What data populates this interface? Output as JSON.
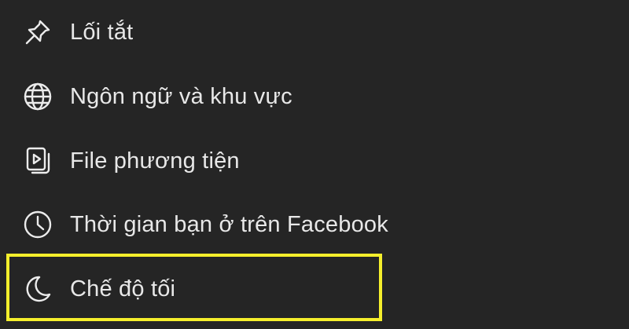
{
  "menu": {
    "items": [
      {
        "label": "Lối tắt",
        "icon": "pin-icon"
      },
      {
        "label": "Ngôn ngữ và khu vực",
        "icon": "globe-icon"
      },
      {
        "label": "File phương tiện",
        "icon": "media-icon"
      },
      {
        "label": "Thời gian bạn ở trên Facebook",
        "icon": "clock-icon"
      },
      {
        "label": "Chế độ tối",
        "icon": "moon-icon"
      }
    ]
  },
  "highlight": {
    "target": "Chế độ tối",
    "color": "#f5ef2c"
  },
  "colors": {
    "background": "#252525",
    "text": "#e8e8e8"
  }
}
